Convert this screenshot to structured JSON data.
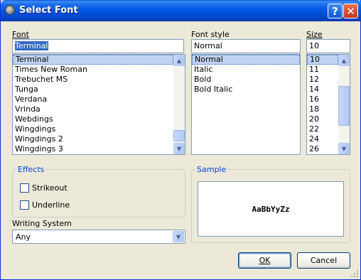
{
  "window": {
    "title": "Select Font",
    "help_label": "?",
    "close_label": "✕"
  },
  "font": {
    "label": "Font",
    "value": "Terminal",
    "items": [
      "Terminal",
      "Times New Roman",
      "Trebuchet MS",
      "Tunga",
      "Verdana",
      "Vrinda",
      "Webdings",
      "Wingdings",
      "Wingdings 2",
      "Wingdings 3"
    ],
    "selected_index": 0
  },
  "style": {
    "label": "Font style",
    "value": "Normal",
    "items": [
      "Normal",
      "Italic",
      "Bold",
      "Bold Italic"
    ],
    "selected_index": 0
  },
  "size": {
    "label": "Size",
    "value": "10",
    "items": [
      "10",
      "11",
      "12",
      "14",
      "16",
      "18",
      "20",
      "22",
      "24",
      "26"
    ],
    "selected_index": 0
  },
  "effects": {
    "title": "Effects",
    "strikeout_label": "Strikeout",
    "underline_label": "Underline",
    "strikeout_checked": false,
    "underline_checked": false
  },
  "sample": {
    "title": "Sample",
    "text": "AaBbYyZz"
  },
  "writing_system": {
    "label": "Writing System",
    "value": "Any"
  },
  "buttons": {
    "ok": "OK",
    "cancel": "Cancel"
  },
  "icons": {
    "up": "▲",
    "down": "▼",
    "dropdown": "▼"
  },
  "colors": {
    "titlebar": "#0054e3",
    "selection": "#316ac5",
    "group_title": "#0046d5"
  }
}
